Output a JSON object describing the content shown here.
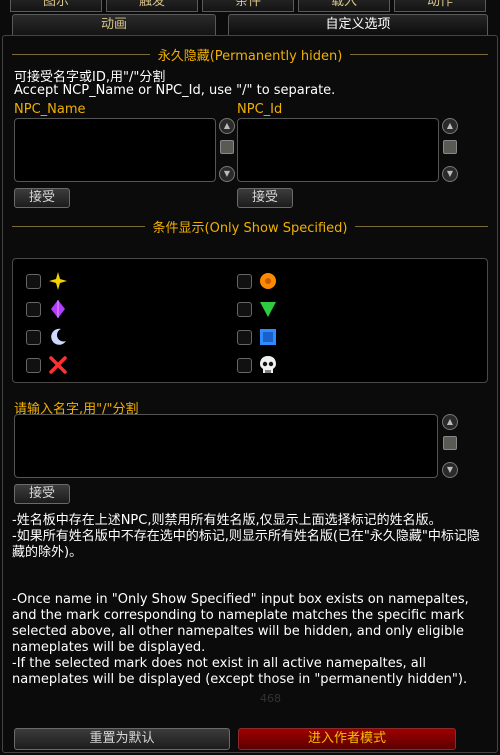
{
  "top_tabs": [
    "图示",
    "触发",
    "条件",
    "载入",
    "动作"
  ],
  "sub_tabs": [
    "动画",
    "自定义选项"
  ],
  "section_hidden": {
    "title": "永久隐藏(Permanently hiden)",
    "desc_cn": "可接受名字或ID,用\"/\"分割",
    "desc_en": "Accept NCP_Name or NPC_Id, use \"/\" to separate.",
    "npc_name_label": "NPC_Name",
    "npc_id_label": "NPC_Id",
    "accept_label": "接受"
  },
  "section_show": {
    "title": "条件显示(Only Show Specified)",
    "marks": [
      {
        "name": "star",
        "color": "#f5d300"
      },
      {
        "name": "circle",
        "color": "#ff8a00"
      },
      {
        "name": "diamond",
        "color": "#b43cff"
      },
      {
        "name": "triangle",
        "color": "#2ecc40"
      },
      {
        "name": "moon",
        "color": "#cfd8ff"
      },
      {
        "name": "square",
        "color": "#2f8cff"
      },
      {
        "name": "cross",
        "color": "#ff3030"
      },
      {
        "name": "skull",
        "color": "#f0f0f0"
      }
    ],
    "input_label": "请输入名字,用\"/\"分割",
    "accept_label": "接受"
  },
  "info": {
    "cn": "-姓名板中存在上述NPC,则禁用所有姓名版,仅显示上面选择标记的姓名版。\n-如果所有姓名版中不存在选中的标记,则显示所有姓名版(已在\"永久隐藏\"中标记隐藏的除外)。",
    "en": "-Once name in \"Only Show Specified\" input box exists on namepaltes, and the mark corresponding to nameplate matches the specific mark selected above, all other namepaltes will be hidden, and only eligible nameplates will be displayed.\n-If the selected mark does not exist in all active namepaltes, all nameplates will be displayed (except those in \"permanently hidden\")."
  },
  "footer": {
    "reset_label": "重置为默认",
    "author_label": "进入作者模式",
    "faint_numbers": "468"
  }
}
